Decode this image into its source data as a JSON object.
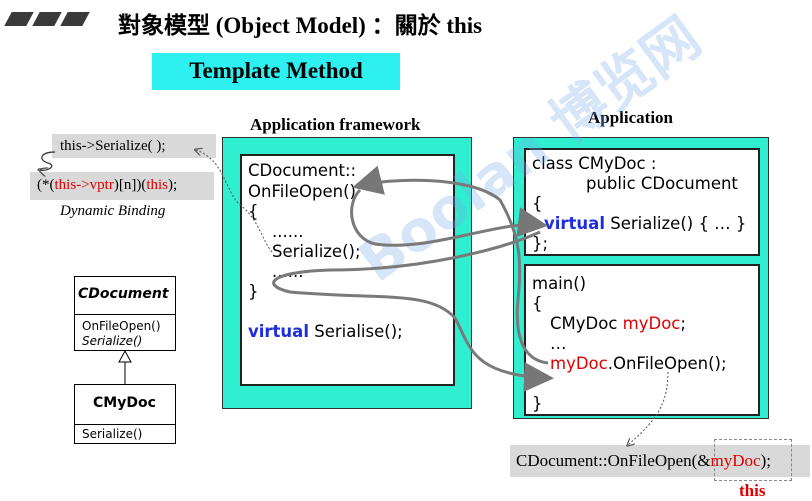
{
  "header": {
    "title": "對象模型 (Object Model) ：關於 this",
    "template_method": "Template Method"
  },
  "labels": {
    "framework": "Application framework",
    "application": "Application"
  },
  "left_notes": {
    "line1": "this->Serialize( );",
    "line2_parts": [
      "(*(",
      "this",
      "->",
      "vptr",
      ")[n])(",
      "this",
      ");"
    ],
    "dynamic_binding": "Dynamic Binding"
  },
  "framework_code": {
    "line1": "CDocument::",
    "line2": "OnFileOpen()",
    "line3": "{",
    "line4": "......",
    "line5": "Serialize();",
    "line6": "......",
    "line7": "}",
    "kw_virtual": "virtual",
    "serialise": "Serialise();"
  },
  "app_class": {
    "line1": "class CMyDoc :",
    "line2": "public CDocument",
    "line3": "{",
    "kw_virtual": "virtual",
    "serialize": "Serialize() { … }",
    "line5": "};"
  },
  "app_main": {
    "line1": "main()",
    "line2": "{",
    "cmydoc": "CMyDoc",
    "mydoc": "myDoc",
    "semicolon": ";",
    "dots": "…",
    "call_obj": "myDoc",
    "call_rest": ".OnFileOpen();",
    "close": "}"
  },
  "uml": {
    "class1": "CDocument",
    "method1": "OnFileOpen()",
    "method2": "Serialize()",
    "class2": "CMyDoc",
    "method3": "Serialize()"
  },
  "bottom": {
    "call_prefix": "CDocument::OnFileOpen(&",
    "call_obj": "myDoc",
    "call_suffix": ");",
    "this_label": "this"
  },
  "watermark": "Boolan 博览网",
  "colors": {
    "cyan": "#2fefd0",
    "title_box": "#2ff0f0",
    "red": "#e00000",
    "keyword": "#1f2de0",
    "grey": "#d9d9d9"
  }
}
